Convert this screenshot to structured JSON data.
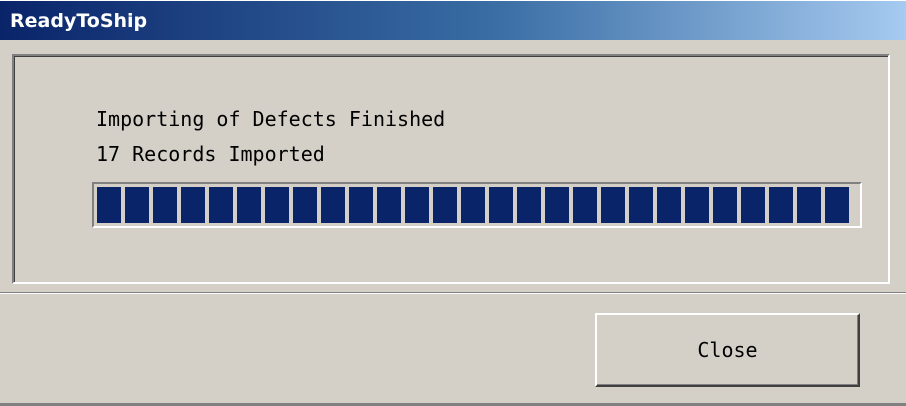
{
  "window": {
    "title": "ReadyToShip"
  },
  "message": {
    "line1": "Importing of Defects Finished",
    "line2": "17 Records Imported"
  },
  "progress": {
    "value_percent": 100,
    "segment_count": 27,
    "fill_color": "#0a246a"
  },
  "buttons": {
    "close_label": "Close"
  },
  "colors": {
    "face": "#d4d0c8",
    "title_start": "#0a246a",
    "title_end": "#a6caf0"
  }
}
